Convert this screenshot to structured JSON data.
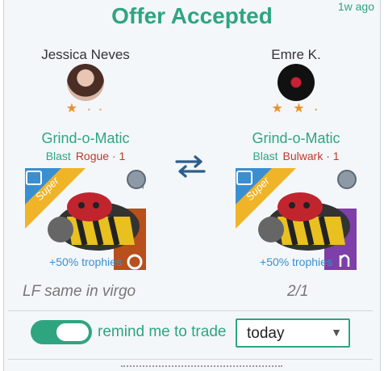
{
  "header": {
    "title": "Offer Accepted",
    "age": "1w ago"
  },
  "left": {
    "user": "Jessica Neves",
    "stars": "★",
    "stars_dim": "• •",
    "card": {
      "name": "Grind-o-Matic",
      "type": "Blast",
      "mod": "Rogue",
      "level": "· 1",
      "rarity": "Super",
      "bonus": "+50% trophies",
      "zodiac_icon": "taurus-icon"
    },
    "note": "LF same in virgo"
  },
  "right": {
    "user": "Emre K.",
    "stars": "★ ★",
    "stars_dim": "•",
    "card": {
      "name": "Grind-o-Matic",
      "type": "Blast",
      "mod": "Bulwark",
      "level": "· 1",
      "rarity": "Super",
      "bonus": "+50% trophies",
      "zodiac_icon": "virgo-icon"
    },
    "note": "2/1"
  },
  "reminder": {
    "label": "remind me to trade",
    "enabled": true,
    "select_value": "today"
  },
  "colors": {
    "accent": "#2fa57f",
    "mod": "#c0392b",
    "bonus": "#3a8fd0"
  }
}
